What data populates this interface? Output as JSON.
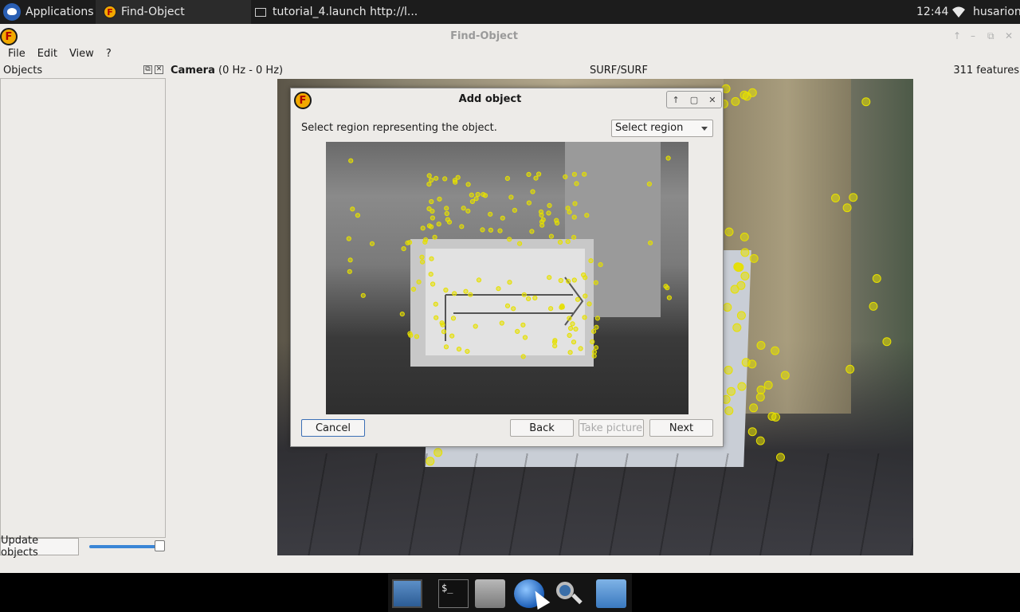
{
  "top_panel": {
    "applications_label": "Applications",
    "task1_label": "Find-Object",
    "task2_label": "tutorial_4.launch http://l...",
    "clock": "12:44",
    "user": "husarion"
  },
  "window": {
    "title": "Find-Object",
    "app_icon_letter": "F",
    "controls": {
      "up": "↑",
      "minimize": "–",
      "maximize": "⧉",
      "close": "✕"
    }
  },
  "menu": {
    "file": "File",
    "edit": "Edit",
    "view": "View",
    "help": "?"
  },
  "objects_dock": {
    "title": "Objects",
    "float_icon": "⧉",
    "close_icon": "✕",
    "update_button": "Update objects",
    "slider_value": 1.0
  },
  "camera": {
    "label": "Camera",
    "rate": " (0 Hz - 0 Hz)",
    "algorithm": "SURF/SURF",
    "features": "311 features",
    "keypoint_color": "#e6e000"
  },
  "dialog": {
    "title": "Add object",
    "icon_letter": "F",
    "instruction": "Select region representing the object.",
    "select_value": "Select region",
    "controls": {
      "up": "↑",
      "maximize": "▢",
      "close": "✕"
    },
    "buttons": {
      "cancel": "Cancel",
      "back": "Back",
      "take_picture": "Take picture",
      "next": "Next"
    }
  },
  "dock": {
    "terminal_text": "$_"
  }
}
